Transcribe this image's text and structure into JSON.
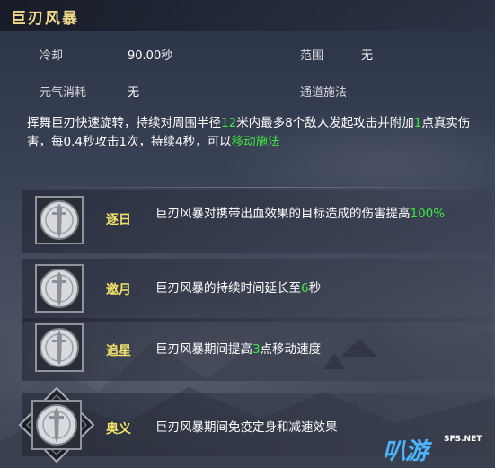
{
  "skill": {
    "title": "巨刃风暴"
  },
  "stats": {
    "cooldown_label": "冷却",
    "cooldown_value": "90.00秒",
    "range_label": "范围",
    "range_value": "无",
    "energy_label": "元气消耗",
    "energy_value": "无",
    "channel_label": "通道施法"
  },
  "description": {
    "p1": "挥舞巨刃快速旋转，持续对周围半径",
    "radius": "12",
    "p2": "米内最多8个敌人发起攻击并附加",
    "damage": "1",
    "p3": "点真实伤害，每0.4秒攻击1次，持续4秒，可以",
    "link": "移动施法"
  },
  "talents": [
    {
      "name": "逐日",
      "icon": "sword-medallion-icon",
      "desc_before": "巨刃风暴对携带出血效果的目标造成的伤害提高",
      "value": "100%",
      "desc_after": ""
    },
    {
      "name": "邀月",
      "icon": "sword-medallion-icon",
      "desc_before": "巨刃风暴的持续时间延长至",
      "value": "6",
      "desc_after": "秒"
    },
    {
      "name": "追星",
      "icon": "sword-medallion-icon",
      "desc_before": "巨刃风暴期间提高",
      "value": "3",
      "desc_after": "点移动速度"
    },
    {
      "name": "奥义",
      "icon": "sword-medallion-icon",
      "desc_before": "巨刃风暴期间免疫定身和减速效果",
      "value": "",
      "desc_after": ""
    }
  ],
  "watermark": {
    "main": "叭游",
    "sub": "SFS.NET"
  },
  "colors": {
    "title": "#f2d98a",
    "talent_name": "#f2e26a",
    "highlight": "#3fe83f"
  }
}
